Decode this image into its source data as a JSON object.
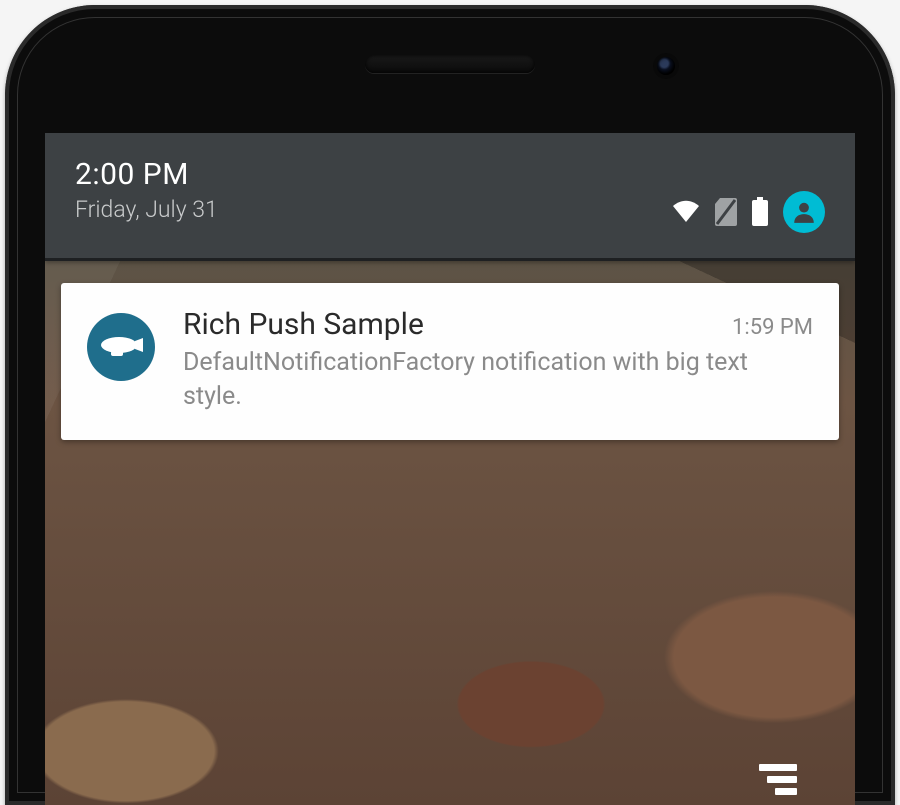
{
  "statusbar": {
    "time": "2:00 PM",
    "date": "Friday, July 31",
    "icons": {
      "wifi": "wifi-icon",
      "sim": "no-sim-icon",
      "battery": "battery-icon",
      "profile": "profile-icon"
    },
    "accent_color": "#00bcd4"
  },
  "notification": {
    "app_icon": "airship-icon",
    "app_icon_bg": "#1f6e8c",
    "title": "Rich Push Sample",
    "timestamp": "1:59 PM",
    "body": "DefaultNotificationFactory notification with big text style."
  },
  "actions": {
    "clear_all": "clear-all"
  }
}
